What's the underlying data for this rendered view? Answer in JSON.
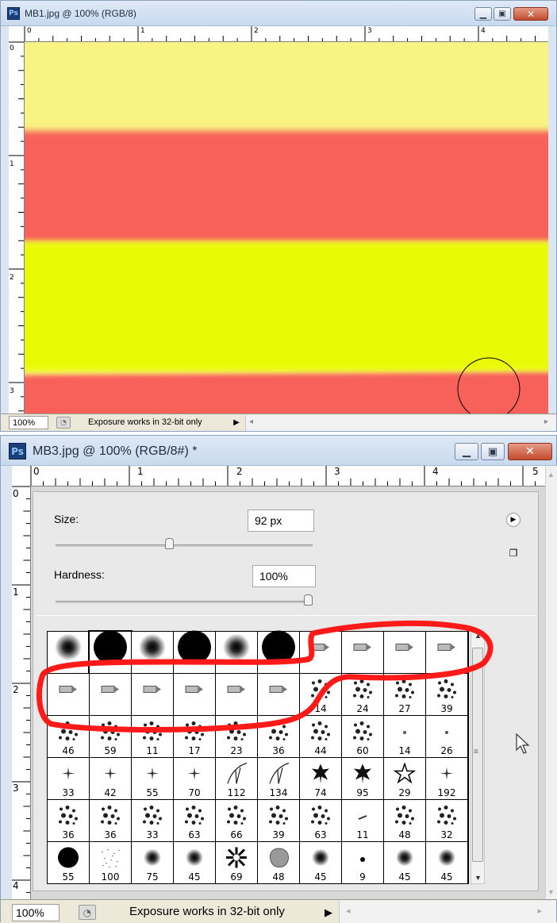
{
  "window1": {
    "title": "MB1.jpg @ 100% (RGB/8)",
    "ps_logo": "Ps",
    "ruler_h_labels": [
      "0",
      "1",
      "2",
      "3",
      "4"
    ],
    "ruler_v_labels": [
      "0",
      "1",
      "2",
      "3"
    ],
    "status": {
      "zoom": "100%",
      "message": "Exposure works in 32-bit only"
    },
    "colors": {
      "light_yellow": "#f9f383",
      "coral": "#f8605a",
      "yellow": "#eafa05"
    },
    "icons": {
      "minimize": "minimize-icon",
      "maximize": "maximize-icon",
      "close": "close-icon",
      "brush_cursor": "circle-brush-cursor"
    }
  },
  "window2": {
    "title": "MB3.jpg @ 100% (RGB/8#) *",
    "ps_logo": "Ps",
    "ruler_h_labels": [
      "0",
      "1",
      "2",
      "3",
      "4",
      "5"
    ],
    "ruler_v_labels": [
      "0",
      "1",
      "2",
      "3",
      "4"
    ],
    "status": {
      "zoom": "100%",
      "message": "Exposure works in 32-bit only"
    },
    "brush_picker": {
      "size_label": "Size:",
      "size_value": "92 px",
      "size_slider_fraction": 0.44,
      "hardness_label": "Hardness:",
      "hardness_value": "100%",
      "hardness_slider_fraction": 1.0,
      "menu_icon": "flyout-menu-arrow-icon",
      "new_preset_icon": "new-preset-icon",
      "highlight_color": "#ff1a1a",
      "rows": [
        [
          {
            "kind": "soft",
            "num": ""
          },
          {
            "kind": "hard",
            "num": ""
          },
          {
            "kind": "soft",
            "num": ""
          },
          {
            "kind": "hard",
            "num": ""
          },
          {
            "kind": "soft",
            "num": ""
          },
          {
            "kind": "hard",
            "num": ""
          },
          {
            "kind": "tip",
            "num": ""
          },
          {
            "kind": "tip",
            "num": ""
          },
          {
            "kind": "tip",
            "num": ""
          },
          {
            "kind": "tip",
            "num": ""
          }
        ],
        [
          {
            "kind": "tip",
            "num": ""
          },
          {
            "kind": "tip",
            "num": ""
          },
          {
            "kind": "tip",
            "num": ""
          },
          {
            "kind": "tip",
            "num": ""
          },
          {
            "kind": "tip",
            "num": ""
          },
          {
            "kind": "tip",
            "num": ""
          },
          {
            "kind": "scatter",
            "num": "14"
          },
          {
            "kind": "scatter",
            "num": "24"
          },
          {
            "kind": "scatter",
            "num": "27"
          },
          {
            "kind": "scatter",
            "num": "39"
          }
        ],
        [
          {
            "kind": "scatter",
            "num": "46"
          },
          {
            "kind": "scatter",
            "num": "59"
          },
          {
            "kind": "scatter",
            "num": "11"
          },
          {
            "kind": "scatter",
            "num": "17"
          },
          {
            "kind": "scatter",
            "num": "23"
          },
          {
            "kind": "scatter",
            "num": "36"
          },
          {
            "kind": "scatter",
            "num": "44"
          },
          {
            "kind": "scatter",
            "num": "60"
          },
          {
            "kind": "dot",
            "num": "14"
          },
          {
            "kind": "dot",
            "num": "26"
          }
        ],
        [
          {
            "kind": "star",
            "num": "33"
          },
          {
            "kind": "star",
            "num": "42"
          },
          {
            "kind": "star",
            "num": "55"
          },
          {
            "kind": "star",
            "num": "70"
          },
          {
            "kind": "grass",
            "num": "112"
          },
          {
            "kind": "grass",
            "num": "134"
          },
          {
            "kind": "leaf",
            "num": "74"
          },
          {
            "kind": "leaf",
            "num": "95"
          },
          {
            "kind": "starout",
            "num": "29"
          },
          {
            "kind": "star",
            "num": "192"
          }
        ],
        [
          {
            "kind": "scatter",
            "num": "36"
          },
          {
            "kind": "scatter",
            "num": "36"
          },
          {
            "kind": "scatter",
            "num": "33"
          },
          {
            "kind": "scatter",
            "num": "63"
          },
          {
            "kind": "scatter",
            "num": "66"
          },
          {
            "kind": "scatter",
            "num": "39"
          },
          {
            "kind": "scatter",
            "num": "63"
          },
          {
            "kind": "dash",
            "num": "11"
          },
          {
            "kind": "scatter",
            "num": "48"
          },
          {
            "kind": "scatter",
            "num": "32"
          }
        ],
        [
          {
            "kind": "hardsm",
            "num": "55"
          },
          {
            "kind": "noise",
            "num": "100"
          },
          {
            "kind": "softsm",
            "num": "75"
          },
          {
            "kind": "softsm",
            "num": "45"
          },
          {
            "kind": "flower",
            "num": "69"
          },
          {
            "kind": "blob",
            "num": "48"
          },
          {
            "kind": "softsm",
            "num": "45"
          },
          {
            "kind": "softxs",
            "num": "9"
          },
          {
            "kind": "softsm",
            "num": "45"
          },
          {
            "kind": "softsm",
            "num": "45"
          }
        ]
      ]
    }
  }
}
